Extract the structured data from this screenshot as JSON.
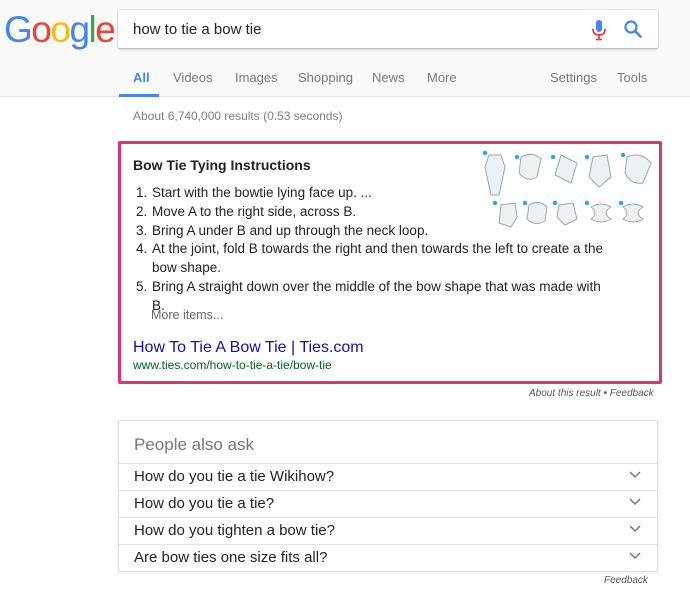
{
  "logo": {
    "letters": [
      "G",
      "o",
      "o",
      "g",
      "l",
      "e"
    ],
    "colors": [
      "#4285f4",
      "#ea4335",
      "#fbbc05",
      "#4285f4",
      "#34a853",
      "#ea4335"
    ]
  },
  "search": {
    "query": "how to tie a bow tie",
    "mic_icon": "mic-icon",
    "search_icon": "search-icon"
  },
  "tabs": [
    "All",
    "Videos",
    "Images",
    "Shopping",
    "News",
    "More",
    "Settings",
    "Tools"
  ],
  "accent_color": "#4285f4",
  "result_stats": "About 6,740,000 results (0.53 seconds)",
  "snippet": {
    "title": "Bow Tie Tying Instructions",
    "steps": [
      {
        "num": "1.",
        "text": "Start with the bowtie lying face up. ..."
      },
      {
        "num": "2.",
        "text": "Move A to the right side, across B."
      },
      {
        "num": "3.",
        "text": "Bring A under B and up through the neck loop."
      },
      {
        "num": "4.",
        "text": "At the joint, fold B towards the right and then towards the left to create a the bow shape."
      },
      {
        "num": "5.",
        "text": "Bring A straight down over the middle of the bow shape that was made with B."
      }
    ],
    "more_items": "More items...",
    "link_title": "How To Tie A Bow Tie | Ties.com",
    "url": "www.ties.com/how-to-tie-a-tie/bow-tie",
    "border_color": "#e0336e"
  },
  "about_result": "About this result • Feedback",
  "people_also_ask": {
    "title": "People also ask",
    "questions": [
      "How do you tie a tie Wikihow?",
      "How do you tie a tie?",
      "How do you tighten a bow tie?",
      "Are bow ties one size fits all?"
    ],
    "feedback": "Feedback"
  }
}
